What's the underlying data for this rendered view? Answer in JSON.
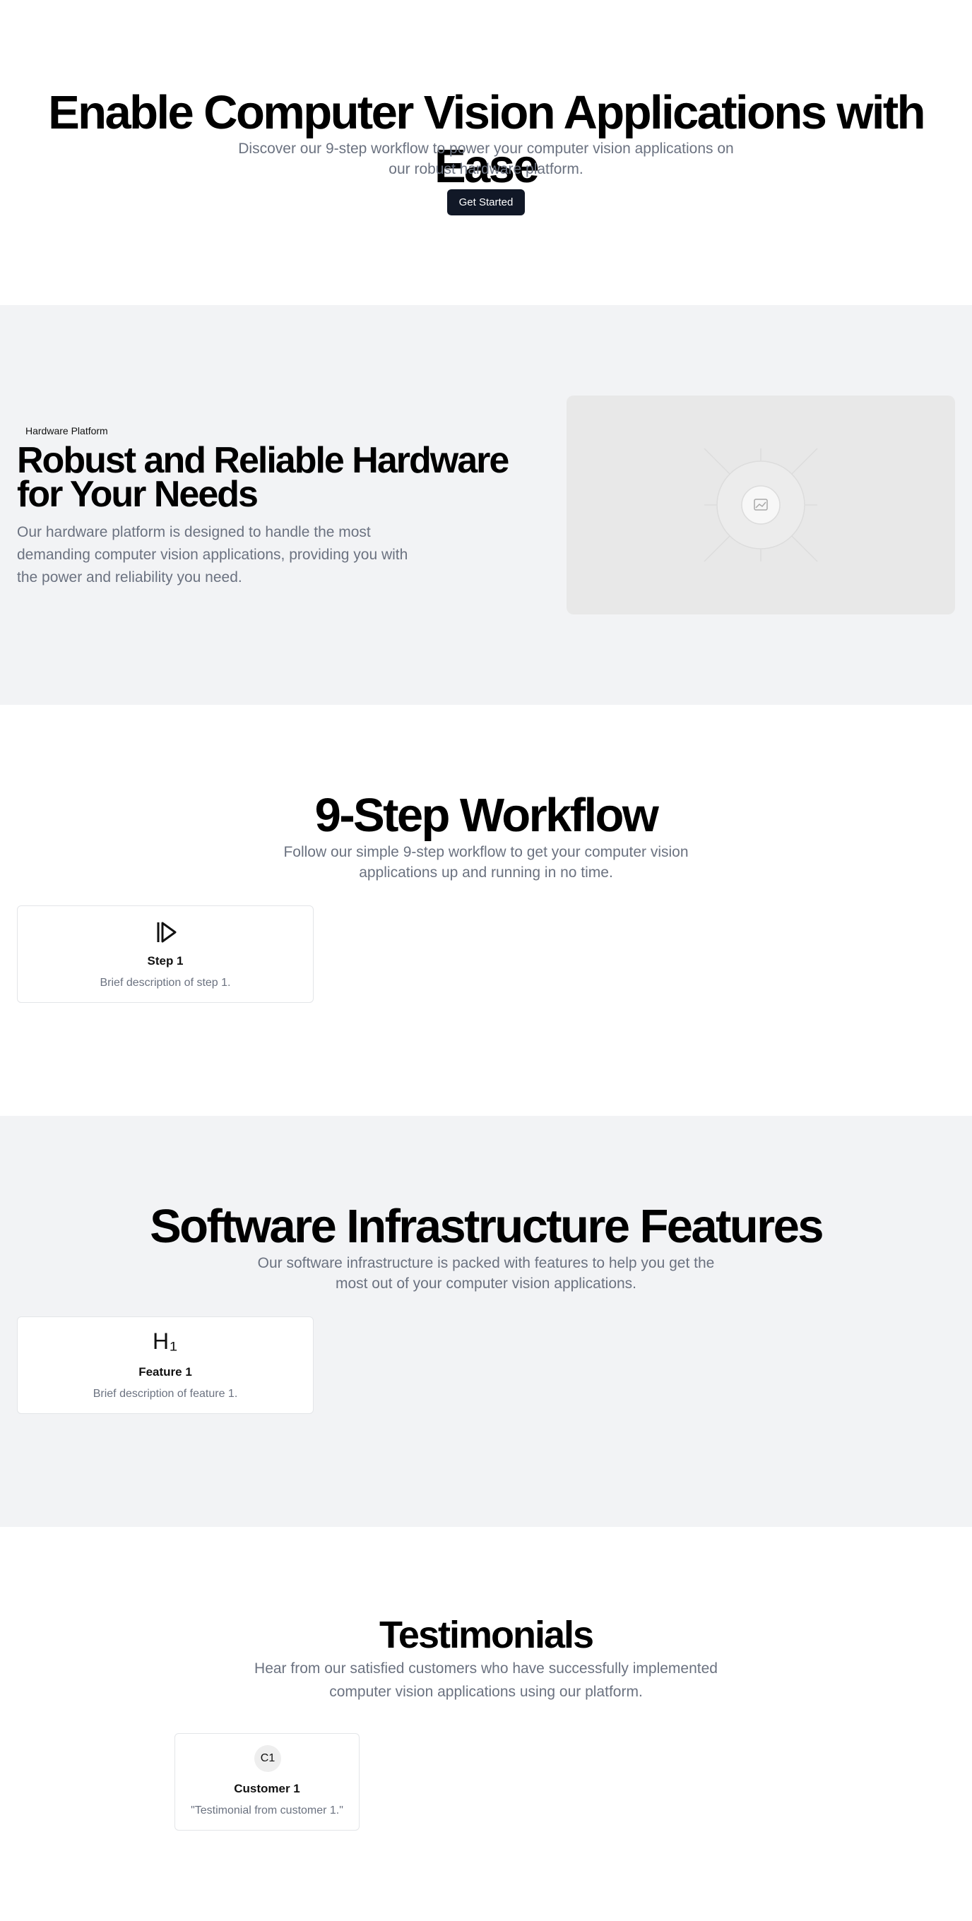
{
  "hero": {
    "title": "Enable Computer Vision Applications with Ease",
    "subtitle": "Discover our 9-step workflow to power your computer vision applications on our robust hardware platform.",
    "cta_label": "Get Started"
  },
  "hardware": {
    "badge": "Hardware Platform",
    "title": "Robust and Reliable Hardware for Your Needs",
    "description": "Our hardware platform is designed to handle the most demanding computer vision applications, providing you with the power and reliability you need.",
    "image_icon": "image-placeholder-icon"
  },
  "workflow": {
    "title": "9-Step Workflow",
    "subtitle": "Follow our simple 9-step workflow to get your computer vision applications up and running in no time.",
    "steps": [
      {
        "icon": "play-step-icon",
        "title": "Step 1",
        "description": "Brief description of step 1."
      }
    ]
  },
  "features": {
    "title": "Software Infrastructure Features",
    "subtitle": "Our software infrastructure is packed with features to help you get the most out of your computer vision applications.",
    "items": [
      {
        "icon": "heading-1-icon",
        "icon_glyph": "H₁",
        "title": "Feature 1",
        "description": "Brief description of feature 1."
      }
    ]
  },
  "testimonials": {
    "title": "Testimonials",
    "subtitle": "Hear from our satisfied customers who have successfully implemented computer vision applications using our platform.",
    "items": [
      {
        "avatar": "C1",
        "name": "Customer 1",
        "quote": "\"Testimonial from customer 1.\""
      }
    ]
  },
  "colors": {
    "primary_button": "#111827",
    "muted_text": "#6b7280",
    "section_alt_bg": "#f2f3f5"
  }
}
